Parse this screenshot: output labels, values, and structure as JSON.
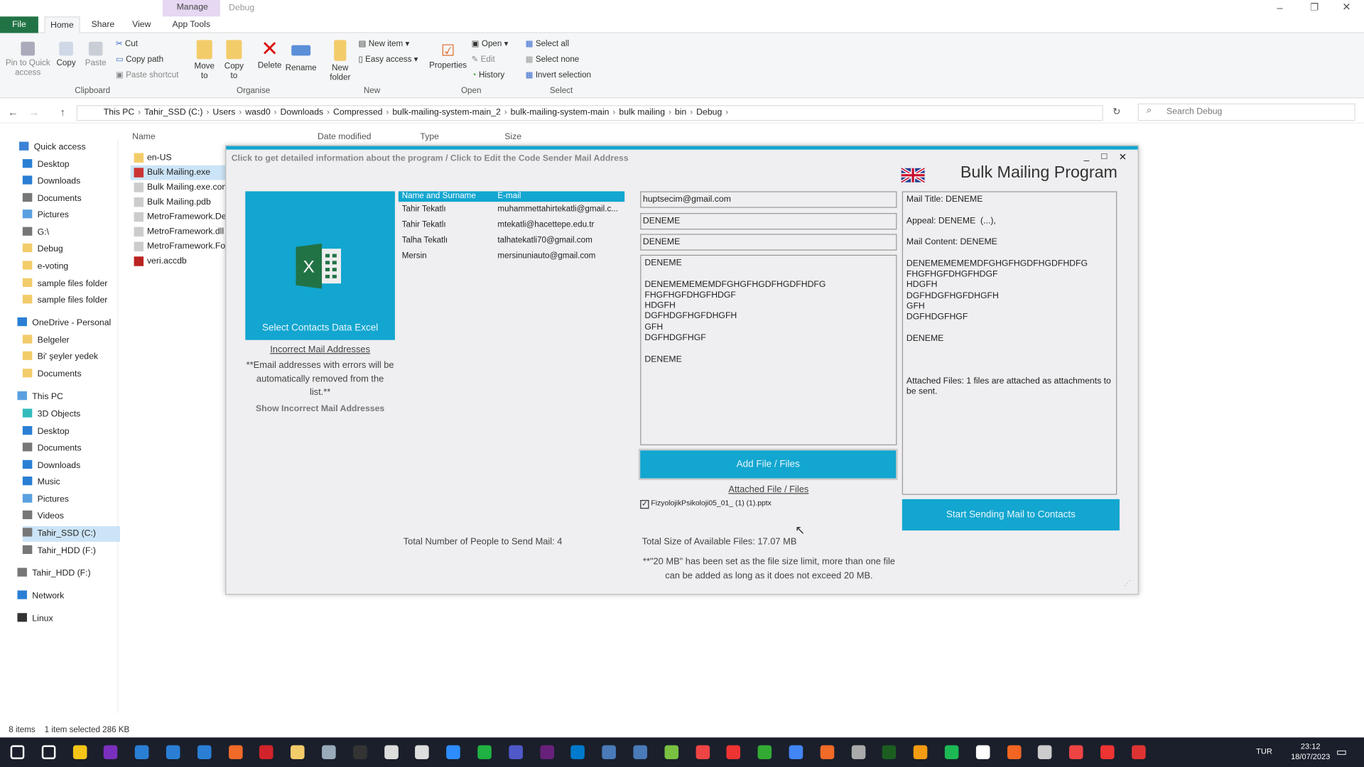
{
  "explorer": {
    "ctx_tabs": {
      "manage": "Manage",
      "debug": "Debug"
    },
    "tabs": [
      "File",
      "Home",
      "Share",
      "View",
      "App Tools"
    ],
    "ribbon": {
      "clipboard": {
        "pin": "Pin to Quick access",
        "copy": "Copy",
        "paste": "Paste",
        "cut": "Cut",
        "copy_path": "Copy path",
        "paste_shortcut": "Paste shortcut",
        "group": "Clipboard"
      },
      "organise": {
        "move": "Move to",
        "copy": "Copy to",
        "delete": "Delete",
        "rename": "Rename",
        "group": "Organise"
      },
      "new": {
        "new_folder": "New folder",
        "new_item": "New item",
        "easy_access": "Easy access",
        "group": "New"
      },
      "open": {
        "properties": "Properties",
        "open": "Open",
        "edit": "Edit",
        "history": "History",
        "group": "Open"
      },
      "select": {
        "all": "Select all",
        "none": "Select none",
        "invert": "Invert selection",
        "group": "Select"
      }
    },
    "breadcrumb": [
      "This PC",
      "Tahir_SSD (C:)",
      "Users",
      "wasd0",
      "Downloads",
      "Compressed",
      "bulk-mailing-system-main_2",
      "bulk-mailing-system-main",
      "bulk mailing",
      "bin",
      "Debug"
    ],
    "search_placeholder": "Search Debug",
    "columns": [
      "Name",
      "Date modified",
      "Type",
      "Size"
    ],
    "nav": [
      "Quick access",
      "Desktop",
      "Downloads",
      "Documents",
      "Pictures",
      "G:\\",
      "Debug",
      "e-voting",
      "sample files folder",
      "sample files folder",
      "OneDrive - Personal",
      "Belgeler",
      "Bi' şeyler yedek",
      "Documents",
      "This PC",
      "3D Objects",
      "Desktop",
      "Documents",
      "Downloads",
      "Music",
      "Pictures",
      "Videos",
      "Tahir_SSD (C:)",
      "Tahir_HDD (F:)",
      "Tahir_HDD (F:)",
      "Network",
      "Linux"
    ],
    "files": [
      "en-US",
      "Bulk Mailing.exe",
      "Bulk Mailing.exe.config",
      "Bulk Mailing.pdb",
      "MetroFramework.Design.dll",
      "MetroFramework.dll",
      "MetroFramework.Fonts.dll",
      "veri.accdb"
    ],
    "status": {
      "items": "8 items",
      "selected": "1 item selected  286 KB"
    }
  },
  "app": {
    "info_link": "Click to get detailed information about the program / Click to Edit the Code Sender Mail Address",
    "title": "Bulk Mailing Program",
    "select_excel": "Select Contacts Data Excel",
    "incorrect_title": "Incorrect Mail Addresses",
    "incorrect_note": "**Email addresses with errors will be automatically removed from the list.**",
    "show_incorrect": "Show Incorrect Mail Addresses",
    "grid_headers": [
      "Name and Surname",
      "E-mail"
    ],
    "contacts": [
      {
        "name": "Tahir Tekatlı",
        "email": "muhammettahirtekatli@gmail.c..."
      },
      {
        "name": "Tahir Tekatlı",
        "email": "mtekatli@hacettepe.edu.tr"
      },
      {
        "name": "Talha Tekatlı",
        "email": "talhatekatli70@gmail.com"
      },
      {
        "name": "Mersin",
        "email": "mersinuniauto@gmail.com"
      }
    ],
    "sender": "huptsecim@gmail.com",
    "subject": "DENEME",
    "appeal": "DENEME",
    "content": "DENEME\n\nDENEMEMEMEMDFGHGFHGDFHGDFHDFG\nFHGFHGFDHGFHDGF\nHDGFH\nDGFHDGFHGFDHGFH\nGFH\nDGFHDGFHGF\n\nDENEME",
    "add_file": "Add File / Files",
    "attached_title": "Attached File / Files",
    "attached_file": "FizyolojikPsikoloji05_01_ (1) (1).pptx",
    "attached_checked": true,
    "total_people": "Total Number of People to Send Mail: 4",
    "total_size": "Total Size of Available Files: 17.07 MB",
    "size_note": "**\"20 MB\" has been set as the file size limit, more than one file can be added as long as it does not exceed 20 MB.",
    "preview": "Mail Title: DENEME\n\nAppeal: DENEME  (...),\n\nMail Content: DENEME\n\nDENEMEMEMEMDFGHGFHGDFHGDFHDFG\nFHGFHGFDHGFHDGF\nHDGFH\nDGFHDGFHGFDHGFH\nGFH\nDGFHDGFHGF\n\nDENEME\n\n\n\nAttached Files: 1 files are attached as attachments to be sent.",
    "start": "Start Sending Mail to Contacts",
    "accent": "#12a6d0"
  },
  "taskbar": {
    "lang": "TUR",
    "time": "23:12",
    "date": "18/07/2023"
  }
}
